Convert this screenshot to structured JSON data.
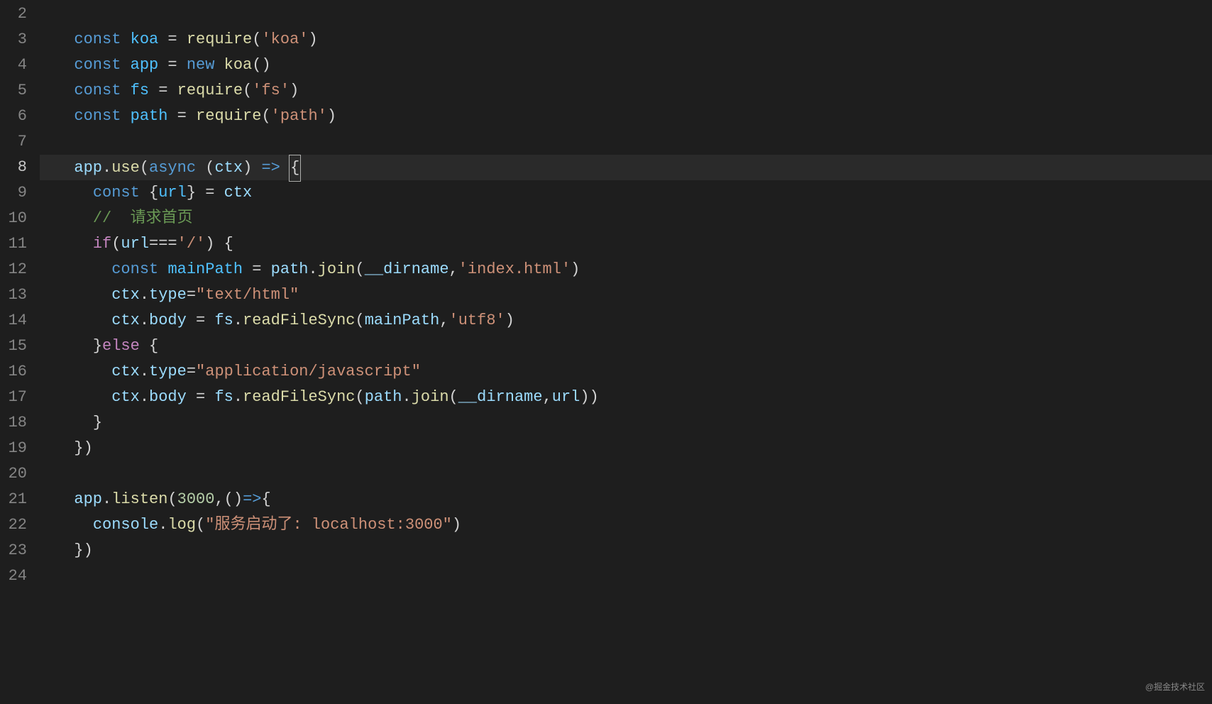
{
  "watermark": "@掘金技术社区",
  "gutter": {
    "start": 2,
    "end": 24,
    "active": 8
  },
  "code": {
    "lines": [
      {
        "n": 2,
        "indent": 0,
        "tokens": []
      },
      {
        "n": 3,
        "indent": 1,
        "tokens": [
          {
            "t": "const ",
            "c": "tok-kw"
          },
          {
            "t": "koa",
            "c": "tok-const"
          },
          {
            "t": " = ",
            "c": "tok-op"
          },
          {
            "t": "require",
            "c": "tok-fn"
          },
          {
            "t": "(",
            "c": "tok-punc"
          },
          {
            "t": "'koa'",
            "c": "tok-str"
          },
          {
            "t": ")",
            "c": "tok-punc"
          }
        ]
      },
      {
        "n": 4,
        "indent": 1,
        "tokens": [
          {
            "t": "const ",
            "c": "tok-kw"
          },
          {
            "t": "app",
            "c": "tok-const"
          },
          {
            "t": " = ",
            "c": "tok-op"
          },
          {
            "t": "new ",
            "c": "tok-kw"
          },
          {
            "t": "koa",
            "c": "tok-fn"
          },
          {
            "t": "()",
            "c": "tok-punc"
          }
        ]
      },
      {
        "n": 5,
        "indent": 1,
        "tokens": [
          {
            "t": "const ",
            "c": "tok-kw"
          },
          {
            "t": "fs",
            "c": "tok-const"
          },
          {
            "t": " = ",
            "c": "tok-op"
          },
          {
            "t": "require",
            "c": "tok-fn"
          },
          {
            "t": "(",
            "c": "tok-punc"
          },
          {
            "t": "'fs'",
            "c": "tok-str"
          },
          {
            "t": ")",
            "c": "tok-punc"
          }
        ]
      },
      {
        "n": 6,
        "indent": 1,
        "tokens": [
          {
            "t": "const ",
            "c": "tok-kw"
          },
          {
            "t": "path",
            "c": "tok-const"
          },
          {
            "t": " = ",
            "c": "tok-op"
          },
          {
            "t": "require",
            "c": "tok-fn"
          },
          {
            "t": "(",
            "c": "tok-punc"
          },
          {
            "t": "'path'",
            "c": "tok-str"
          },
          {
            "t": ")",
            "c": "tok-punc"
          }
        ]
      },
      {
        "n": 7,
        "indent": 0,
        "tokens": []
      },
      {
        "n": 8,
        "indent": 1,
        "active": true,
        "tokens": [
          {
            "t": "app",
            "c": "tok-var"
          },
          {
            "t": ".",
            "c": "tok-punc"
          },
          {
            "t": "use",
            "c": "tok-fn"
          },
          {
            "t": "(",
            "c": "tok-punc"
          },
          {
            "t": "async ",
            "c": "tok-storage"
          },
          {
            "t": "(",
            "c": "tok-punc"
          },
          {
            "t": "ctx",
            "c": "tok-var"
          },
          {
            "t": ") ",
            "c": "tok-punc"
          },
          {
            "t": "=>",
            "c": "tok-kw"
          },
          {
            "t": " ",
            "c": "tok-punc"
          },
          {
            "t": "{",
            "c": "tok-punc",
            "cursor": true
          }
        ]
      },
      {
        "n": 9,
        "indent": 2,
        "guides": 1,
        "tokens": [
          {
            "t": "const ",
            "c": "tok-kw"
          },
          {
            "t": "{",
            "c": "tok-punc"
          },
          {
            "t": "url",
            "c": "tok-const"
          },
          {
            "t": "}",
            "c": "tok-punc"
          },
          {
            "t": " = ",
            "c": "tok-op"
          },
          {
            "t": "ctx",
            "c": "tok-var"
          }
        ]
      },
      {
        "n": 10,
        "indent": 2,
        "guides": 1,
        "tokens": [
          {
            "t": "//  请求首页",
            "c": "tok-cmt"
          }
        ]
      },
      {
        "n": 11,
        "indent": 2,
        "guides": 1,
        "tokens": [
          {
            "t": "if",
            "c": "tok-ctrl"
          },
          {
            "t": "(",
            "c": "tok-punc"
          },
          {
            "t": "url",
            "c": "tok-var"
          },
          {
            "t": "===",
            "c": "tok-op"
          },
          {
            "t": "'/'",
            "c": "tok-str"
          },
          {
            "t": ") {",
            "c": "tok-punc"
          }
        ]
      },
      {
        "n": 12,
        "indent": 3,
        "guides": 2,
        "tokens": [
          {
            "t": "const ",
            "c": "tok-kw"
          },
          {
            "t": "mainPath",
            "c": "tok-const"
          },
          {
            "t": " = ",
            "c": "tok-op"
          },
          {
            "t": "path",
            "c": "tok-var"
          },
          {
            "t": ".",
            "c": "tok-punc"
          },
          {
            "t": "join",
            "c": "tok-fn"
          },
          {
            "t": "(",
            "c": "tok-punc"
          },
          {
            "t": "__dirname",
            "c": "tok-var"
          },
          {
            "t": ",",
            "c": "tok-punc"
          },
          {
            "t": "'index.html'",
            "c": "tok-str"
          },
          {
            "t": ")",
            "c": "tok-punc"
          }
        ]
      },
      {
        "n": 13,
        "indent": 3,
        "guides": 2,
        "tokens": [
          {
            "t": "ctx",
            "c": "tok-var"
          },
          {
            "t": ".",
            "c": "tok-punc"
          },
          {
            "t": "type",
            "c": "tok-var"
          },
          {
            "t": "=",
            "c": "tok-op"
          },
          {
            "t": "\"text/html\"",
            "c": "tok-str"
          }
        ]
      },
      {
        "n": 14,
        "indent": 3,
        "guides": 2,
        "tokens": [
          {
            "t": "ctx",
            "c": "tok-var"
          },
          {
            "t": ".",
            "c": "tok-punc"
          },
          {
            "t": "body",
            "c": "tok-var"
          },
          {
            "t": " = ",
            "c": "tok-op"
          },
          {
            "t": "fs",
            "c": "tok-var"
          },
          {
            "t": ".",
            "c": "tok-punc"
          },
          {
            "t": "readFileSync",
            "c": "tok-fn"
          },
          {
            "t": "(",
            "c": "tok-punc"
          },
          {
            "t": "mainPath",
            "c": "tok-var"
          },
          {
            "t": ",",
            "c": "tok-punc"
          },
          {
            "t": "'utf8'",
            "c": "tok-str"
          },
          {
            "t": ")",
            "c": "tok-punc"
          }
        ]
      },
      {
        "n": 15,
        "indent": 2,
        "guides": 1,
        "tokens": [
          {
            "t": "}",
            "c": "tok-punc"
          },
          {
            "t": "else ",
            "c": "tok-ctrl"
          },
          {
            "t": "{",
            "c": "tok-punc"
          }
        ]
      },
      {
        "n": 16,
        "indent": 3,
        "guides": 2,
        "tokens": [
          {
            "t": "ctx",
            "c": "tok-var"
          },
          {
            "t": ".",
            "c": "tok-punc"
          },
          {
            "t": "type",
            "c": "tok-var"
          },
          {
            "t": "=",
            "c": "tok-op"
          },
          {
            "t": "\"application/javascript\"",
            "c": "tok-str"
          }
        ]
      },
      {
        "n": 17,
        "indent": 3,
        "guides": 2,
        "tokens": [
          {
            "t": "ctx",
            "c": "tok-var"
          },
          {
            "t": ".",
            "c": "tok-punc"
          },
          {
            "t": "body",
            "c": "tok-var"
          },
          {
            "t": " = ",
            "c": "tok-op"
          },
          {
            "t": "fs",
            "c": "tok-var"
          },
          {
            "t": ".",
            "c": "tok-punc"
          },
          {
            "t": "readFileSync",
            "c": "tok-fn"
          },
          {
            "t": "(",
            "c": "tok-punc"
          },
          {
            "t": "path",
            "c": "tok-var"
          },
          {
            "t": ".",
            "c": "tok-punc"
          },
          {
            "t": "join",
            "c": "tok-fn"
          },
          {
            "t": "(",
            "c": "tok-punc"
          },
          {
            "t": "__dirname",
            "c": "tok-var"
          },
          {
            "t": ",",
            "c": "tok-punc"
          },
          {
            "t": "url",
            "c": "tok-var"
          },
          {
            "t": "))",
            "c": "tok-punc"
          }
        ]
      },
      {
        "n": 18,
        "indent": 2,
        "guides": 1,
        "tokens": [
          {
            "t": "}",
            "c": "tok-punc"
          }
        ]
      },
      {
        "n": 19,
        "indent": 1,
        "guides": 0,
        "tokens": [
          {
            "t": "})",
            "c": "tok-punc"
          }
        ]
      },
      {
        "n": 20,
        "indent": 0,
        "tokens": []
      },
      {
        "n": 21,
        "indent": 1,
        "tokens": [
          {
            "t": "app",
            "c": "tok-var"
          },
          {
            "t": ".",
            "c": "tok-punc"
          },
          {
            "t": "listen",
            "c": "tok-fn"
          },
          {
            "t": "(",
            "c": "tok-punc"
          },
          {
            "t": "3000",
            "c": "tok-num"
          },
          {
            "t": ",()",
            "c": "tok-punc"
          },
          {
            "t": "=>",
            "c": "tok-kw"
          },
          {
            "t": "{",
            "c": "tok-punc"
          }
        ]
      },
      {
        "n": 22,
        "indent": 2,
        "guides": 1,
        "tokens": [
          {
            "t": "console",
            "c": "tok-var"
          },
          {
            "t": ".",
            "c": "tok-punc"
          },
          {
            "t": "log",
            "c": "tok-fn"
          },
          {
            "t": "(",
            "c": "tok-punc"
          },
          {
            "t": "\"服务启动了: localhost:3000\"",
            "c": "tok-str"
          },
          {
            "t": ")",
            "c": "tok-punc"
          }
        ]
      },
      {
        "n": 23,
        "indent": 1,
        "tokens": [
          {
            "t": "})",
            "c": "tok-punc"
          }
        ]
      },
      {
        "n": 24,
        "indent": 0,
        "tokens": []
      }
    ]
  }
}
